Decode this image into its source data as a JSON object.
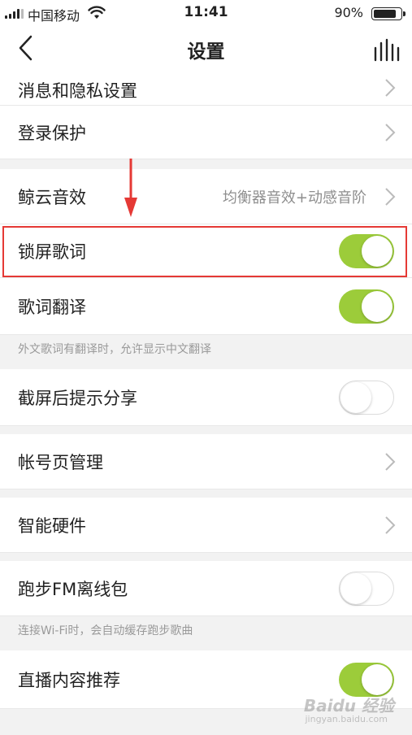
{
  "status_bar": {
    "carrier": "中国移动",
    "time": "11:41",
    "battery_percent": "90%",
    "battery_level": 0.9,
    "signal_icon": "signal-bars-icon",
    "wifi_icon": "wifi-icon"
  },
  "nav": {
    "title": "设置",
    "back_icon": "chevron-left-icon",
    "right_icon": "equalizer-icon"
  },
  "rows": {
    "privacy": {
      "label": "消息和隐私设置"
    },
    "login_protect": {
      "label": "登录保护"
    },
    "sound_effect": {
      "label": "鲸云音效",
      "value": "均衡器音效+动感音阶"
    },
    "lock_screen_lyrics": {
      "label": "锁屏歌词",
      "toggle": true
    },
    "lyrics_translation": {
      "label": "歌词翻译",
      "toggle": true,
      "hint": "外文歌词有翻译时，允许显示中文翻译"
    },
    "screenshot_share": {
      "label": "截屏后提示分享",
      "toggle": false
    },
    "account_page": {
      "label": "帐号页管理"
    },
    "smart_hardware": {
      "label": "智能硬件"
    },
    "running_fm": {
      "label": "跑步FM离线包",
      "toggle": false,
      "hint": "连接Wi-Fi时，会自动缓存跑步歌曲"
    },
    "live_recommend": {
      "label": "直播内容推荐",
      "toggle": true
    }
  },
  "colors": {
    "toggle_on": "#9ccc3a",
    "highlight": "#e53935",
    "arrow": "#e53935"
  },
  "watermark": {
    "main": "Baidu 经验",
    "sub": "jingyan.baidu.com"
  }
}
